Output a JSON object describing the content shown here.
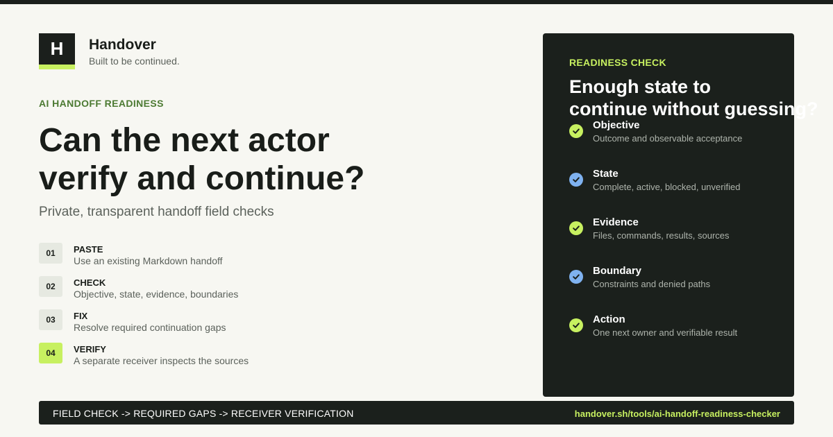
{
  "brand": {
    "logo_letter": "H",
    "name": "Handover",
    "tagline": "Built to be continued."
  },
  "hero": {
    "eyebrow": "AI HANDOFF READINESS",
    "headline_line1": "Can the next actor",
    "headline_line2": "verify and continue?",
    "subhead": "Private, transparent handoff field checks"
  },
  "steps": [
    {
      "number": "01",
      "title": "PASTE",
      "description": "Use an existing Markdown handoff",
      "active": false
    },
    {
      "number": "02",
      "title": "CHECK",
      "description": "Objective, state, evidence, boundaries",
      "active": false
    },
    {
      "number": "03",
      "title": "FIX",
      "description": "Resolve required continuation gaps",
      "active": false
    },
    {
      "number": "04",
      "title": "VERIFY",
      "description": "A separate receiver inspects the sources",
      "active": true
    }
  ],
  "panel": {
    "label": "READINESS CHECK",
    "title_line1": "Enough state to",
    "title_line2": "continue without guessing?",
    "items": [
      {
        "title": "Objective",
        "description": "Outcome and observable acceptance",
        "icon": "check-circle-icon",
        "color": "#c7f060"
      },
      {
        "title": "State",
        "description": "Complete, active, blocked, unverified",
        "icon": "check-circle-icon",
        "color": "#7fb2f0"
      },
      {
        "title": "Evidence",
        "description": "Files, commands, results, sources",
        "icon": "check-circle-icon",
        "color": "#c7f060"
      },
      {
        "title": "Boundary",
        "description": "Constraints and denied paths",
        "icon": "check-circle-icon",
        "color": "#7fb2f0"
      },
      {
        "title": "Action",
        "description": "One next owner and verifiable result",
        "icon": "check-circle-icon",
        "color": "#c7f060"
      }
    ]
  },
  "footer": {
    "flow": "FIELD CHECK -> REQUIRED GAPS -> RECEIVER VERIFICATION",
    "url": "handover.sh/tools/ai-handoff-readiness-checker"
  },
  "colors": {
    "accent": "#c7f060",
    "dark": "#1b201c",
    "background": "#f7f7f2",
    "eyebrow": "#4c7a32",
    "info": "#7fb2f0"
  }
}
